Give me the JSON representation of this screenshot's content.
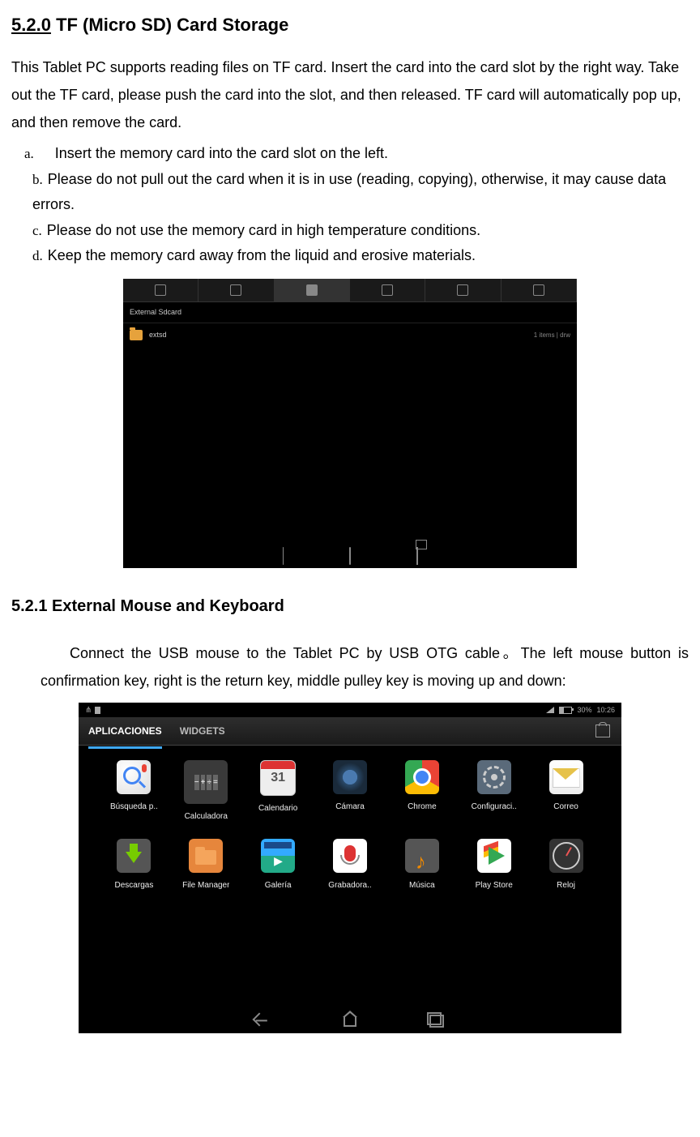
{
  "section520": {
    "number": "5.2.0",
    "title": "TF (Micro SD) Card Storage",
    "intro": "This Tablet PC supports reading files on TF card. Insert the card into the card slot by the right way. Take out the TF card, please push the card into the slot, and then released. TF card will automatically pop up, and then remove the card.",
    "items": {
      "a": "Insert the memory card into the card slot on the left.",
      "b": "Please do not pull out the card when it is in use (reading, copying), otherwise, it may cause data errors.",
      "c": "Please do not use the memory card in high temperature conditions.",
      "d": "Keep the memory card away from the liquid and erosive materials."
    }
  },
  "shot1": {
    "breadcrumb": "External Sdcard",
    "folder": "extsd",
    "meta": "1 items | drw"
  },
  "section521": {
    "number": "5.2.1",
    "title": "External Mouse and Keyboard",
    "body": "Connect the USB mouse to the Tablet PC by USB OTG cable。The left mouse button is confirmation key, right is the return key, middle pulley key is moving up and down:"
  },
  "shot2": {
    "status": {
      "battery": "30%",
      "time": "10:26"
    },
    "tabs": {
      "apps": "APLICACIONES",
      "widgets": "WIDGETS"
    },
    "apps": [
      {
        "label": "Búsqueda p..",
        "icon": "i-search"
      },
      {
        "label": "Calculadora",
        "icon": "i-calc"
      },
      {
        "label": "Calendario",
        "icon": "i-cal"
      },
      {
        "label": "Cámara",
        "icon": "i-cam"
      },
      {
        "label": "Chrome",
        "icon": "i-chrome"
      },
      {
        "label": "Configuraci..",
        "icon": "i-settings"
      },
      {
        "label": "Correo",
        "icon": "i-mail"
      },
      {
        "label": "Descargas",
        "icon": "i-dl"
      },
      {
        "label": "File Manager",
        "icon": "i-fm"
      },
      {
        "label": "Galería",
        "icon": "i-gal"
      },
      {
        "label": "Grabadora..",
        "icon": "i-rec"
      },
      {
        "label": "Música",
        "icon": "i-music"
      },
      {
        "label": "Play Store",
        "icon": "i-play"
      },
      {
        "label": "Reloj",
        "icon": "i-clock"
      }
    ]
  }
}
